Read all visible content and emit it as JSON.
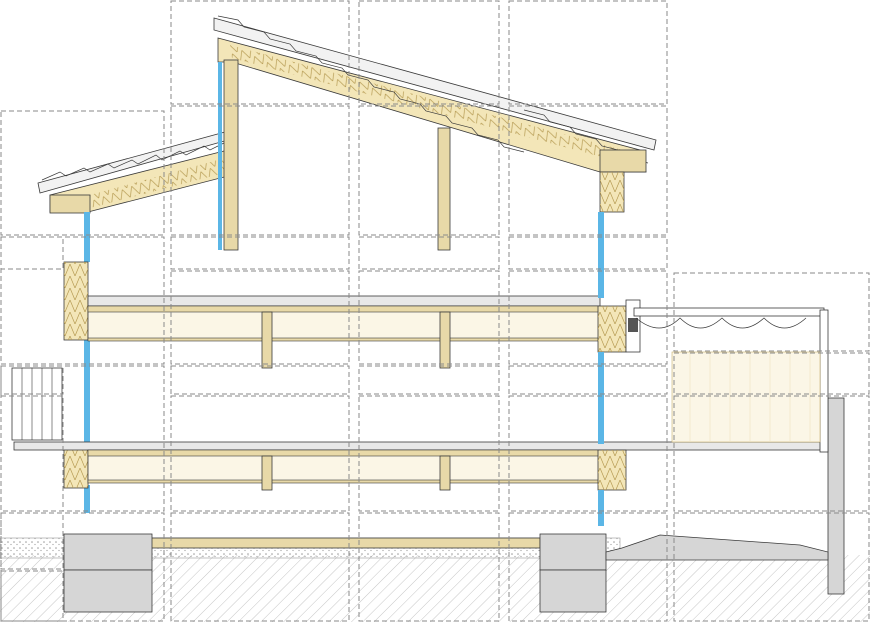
{
  "colors": {
    "timber": "#e8d9a8",
    "timber_dark": "#c9b16e",
    "insulation": "#f3e6b8",
    "insulation_line": "#b59a52",
    "glazing": "#5bb6e6",
    "concrete": "#d6d6d6",
    "gravel": "#e9e9e9",
    "ground_hatch": "#b8b8b8",
    "line": "#3a3a3a",
    "tile_border": "#8a8a8a",
    "slab_fill": "#fbf6e6",
    "roof_tile": "#f2f2f2"
  }
}
